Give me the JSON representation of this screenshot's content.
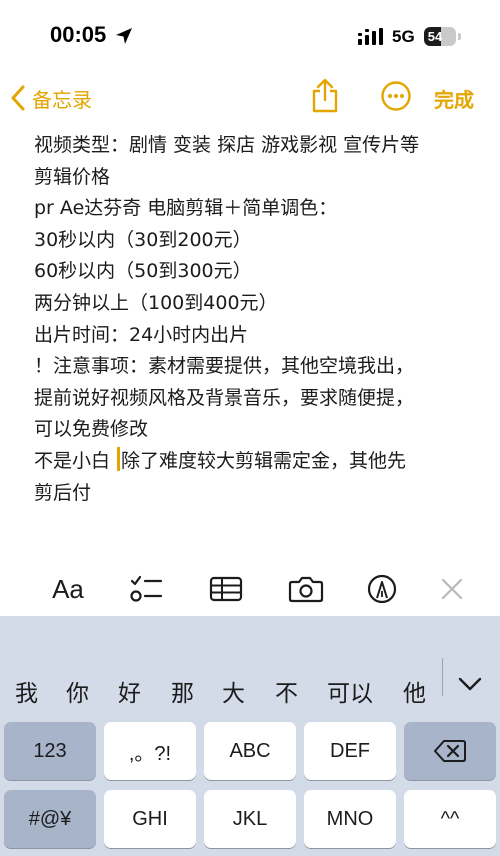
{
  "status": {
    "time": "00:05",
    "network": "5G",
    "battery": {
      "percent": "54",
      "level": 0.54
    }
  },
  "nav": {
    "back_label": "备忘录",
    "done_label": "完成"
  },
  "note": {
    "lines": [
      "视频类型：剧情 变装 探店 游戏影视 宣传片等",
      "剪辑价格",
      "pr  Ae达芬奇 电脑剪辑＋简单调色：",
      "30秒以内（30到200元）",
      "60秒以内（50到300元）",
      "两分钟以上（100到400元）",
      "出片时间：24小时内出片",
      "！注意事项：素材需要提供，其他空境我出，",
      "提前说好视频风格及背景音乐，要求随便提，",
      "可以免费修改",
      "剪后付"
    ],
    "line10_before_caret": "不是小白 ",
    "line10_after_caret": "除了难度较大剪辑需定金，其他先"
  },
  "toolbar": {
    "format_label": "Aa"
  },
  "keyboard": {
    "candidates": [
      "我",
      "你",
      "好",
      "那",
      "大",
      "不",
      "可以",
      "他"
    ],
    "row1": {
      "k1": "123",
      "k2": ",。?!",
      "k3": "ABC",
      "k4": "DEF"
    },
    "row2": {
      "k1": "#@¥",
      "k2": "GHI",
      "k3": "JKL",
      "k4": "MNO",
      "k5": "^^"
    }
  },
  "colors": {
    "accent": "#e3a500",
    "keyboard_bg": "#d4dbe8"
  }
}
